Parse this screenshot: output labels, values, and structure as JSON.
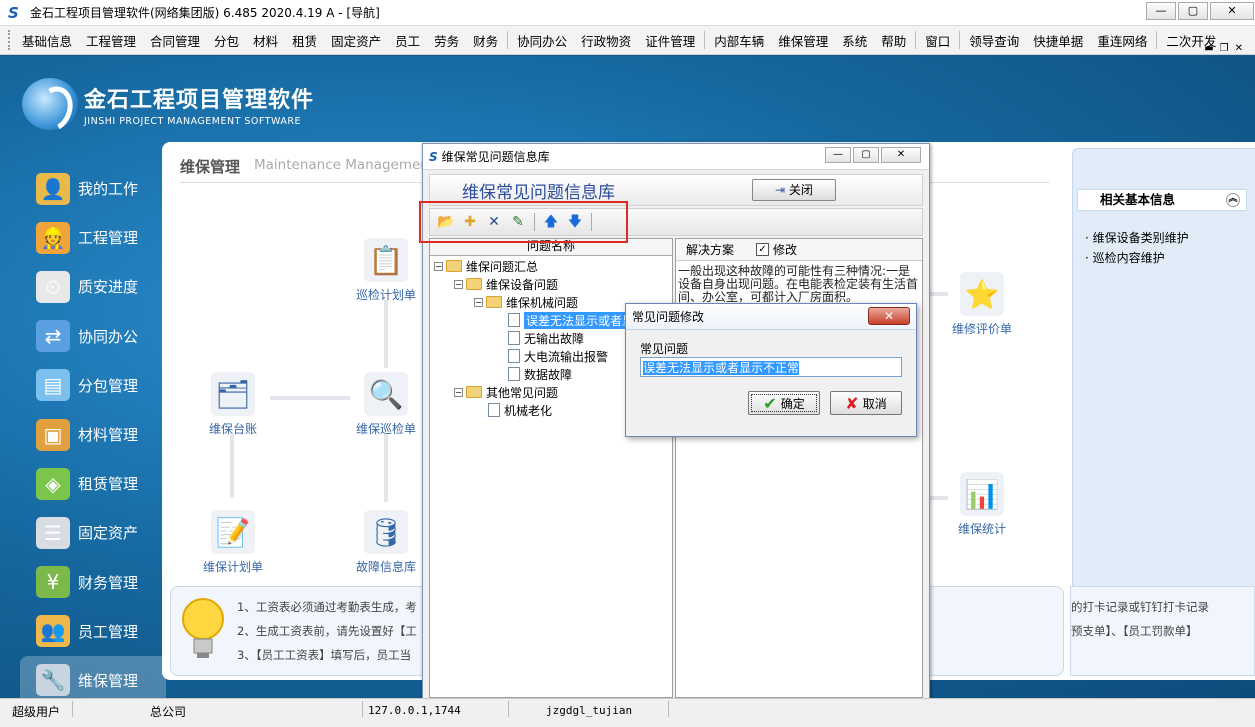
{
  "window": {
    "title": "金石工程项目管理软件(网络集团版) 6.485  2020.4.19 A - [导航]"
  },
  "menubar": {
    "items": [
      "基础信息",
      "工程管理",
      "合同管理",
      "分包",
      "材料",
      "租赁",
      "固定资产",
      "员工",
      "劳务",
      "财务",
      "协同办公",
      "行政物资",
      "证件管理",
      "内部车辆",
      "维保管理",
      "系统",
      "帮助",
      "窗口",
      "领导查询",
      "快捷单据",
      "重连网络",
      "二次开发"
    ]
  },
  "logo": {
    "cn": "金石工程项目管理软件",
    "en": "JINSHI PROJECT MANAGEMENT SOFTWARE"
  },
  "sidebar": {
    "items": [
      "我的工作",
      "工程管理",
      "质安进度",
      "协同办公",
      "分包管理",
      "材料管理",
      "租赁管理",
      "固定资产",
      "财务管理",
      "员工管理",
      "维保管理"
    ]
  },
  "content": {
    "heading": "维保管理",
    "heading_en": "Maintenance Management",
    "nodes": {
      "inspect_plan": "巡检计划单",
      "ledger": "维保台账",
      "inspect_order": "维保巡检单",
      "plan": "维保计划单",
      "fault_lib": "故障信息库",
      "evaluate": "维修评价单",
      "stats": "维保统计"
    },
    "right_panel": {
      "title": "相关基本信息",
      "links": [
        "· 维保设备类别维护",
        "· 巡检内容维护"
      ]
    },
    "tips": [
      "1、工资表必须通过考勤表生成，考",
      "2、生成工资表前，请先设置好【工",
      "3、【员工工资表】填写后，员工当"
    ],
    "tips_right": [
      "的打卡记录或钉钉打卡记录",
      "预支单】、【员工罚款单】"
    ]
  },
  "dialog": {
    "title": "维保常见问题信息库",
    "header": "维保常见问题信息库",
    "close_label": "关闭",
    "tree_header": "问题名称",
    "tree": {
      "root": "维保问题汇总",
      "equipment": "维保设备问题",
      "mechanical": "维保机械问题",
      "items": [
        "误差无法显示或者显示不正常",
        "无输出故障",
        "大电流输出报警",
        "数据故障"
      ],
      "other": "其他常见问题",
      "other_items": [
        "机械老化"
      ]
    },
    "solution_header": "解决方案",
    "edit_label": "修改",
    "solution_text": "一般出现这种故障的可能性有三种情况:一是设备自身出现问题。在电能表检定装有生活首间、办公室，可都计入厂房面积。"
  },
  "edit_dialog": {
    "title": "常见问题修改",
    "label": "常见问题",
    "value": "误差无法显示或者显示不正常",
    "ok": "确定",
    "cancel": "取消"
  },
  "status": {
    "user": "超级用户",
    "company": "总公司",
    "ip": "127.0.0.1,1744",
    "db": "jzgdgl_tujian"
  }
}
